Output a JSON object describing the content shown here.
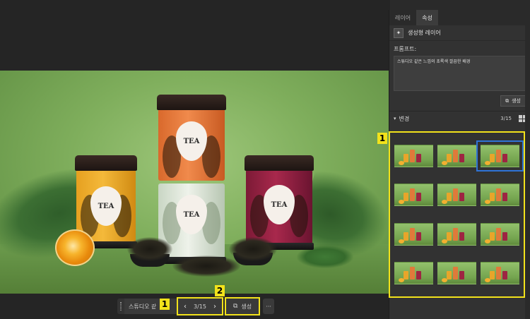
{
  "panel": {
    "tabs": [
      {
        "label": "레이어",
        "active": false
      },
      {
        "label": "속성",
        "active": true
      }
    ],
    "layer_name": "생성형 레이어",
    "prompt_label": "프롬프트:",
    "prompt_text": "스튜디오 같은 느낌의 초록색 깔끔한 배경",
    "generate_label": "생성",
    "variations_label": "변경",
    "variations_count": "3/15",
    "thumbnail_count": 12,
    "selected_index": 2
  },
  "product": {
    "jar_label": "TEA"
  },
  "toolbar": {
    "studio_label": "스튜디오 같",
    "page_indicator": "3/15",
    "generate_label": "생성",
    "more_label": "···"
  },
  "badges": {
    "grid": "1",
    "nav": "1",
    "generate": "2"
  },
  "colors": {
    "highlight": "#f2e21b",
    "selection": "#2f73d6"
  }
}
